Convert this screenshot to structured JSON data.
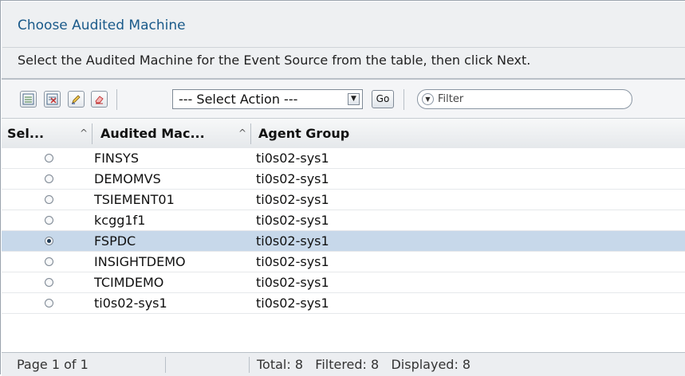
{
  "panel": {
    "title": "Choose Audited Machine",
    "instructions": "Select the Audited Machine for the Event Source from the table, then click Next."
  },
  "toolbar": {
    "icons": [
      "select-all-icon",
      "deselect-all-icon",
      "edit-icon",
      "clear-icon"
    ],
    "action_select": "--- Select Action ---",
    "go_label": "Go",
    "filter_placeholder": "Filter"
  },
  "table": {
    "columns": [
      {
        "label": "Sel...",
        "sort": "^"
      },
      {
        "label": "Audited Mac...",
        "sort": "^"
      },
      {
        "label": "Agent Group"
      }
    ],
    "rows": [
      {
        "machine": "FINSYS",
        "agent_group": "ti0s02-sys1",
        "selected": false
      },
      {
        "machine": "DEMOMVS",
        "agent_group": "ti0s02-sys1",
        "selected": false
      },
      {
        "machine": "TSIEMENT01",
        "agent_group": "ti0s02-sys1",
        "selected": false
      },
      {
        "machine": "kcgg1f1",
        "agent_group": "ti0s02-sys1",
        "selected": false
      },
      {
        "machine": "FSPDC",
        "agent_group": "ti0s02-sys1",
        "selected": true
      },
      {
        "machine": "INSIGHTDEMO",
        "agent_group": "ti0s02-sys1",
        "selected": false
      },
      {
        "machine": "TCIMDEMO",
        "agent_group": "ti0s02-sys1",
        "selected": false
      },
      {
        "machine": "ti0s02-sys1",
        "agent_group": "ti0s02-sys1",
        "selected": false
      }
    ]
  },
  "footer": {
    "page": "Page 1 of 1",
    "totals": "Total: 8   Filtered: 8   Displayed: 8"
  },
  "colors": {
    "title": "#1a5a8a",
    "selected_row": "#c7d8ea"
  }
}
